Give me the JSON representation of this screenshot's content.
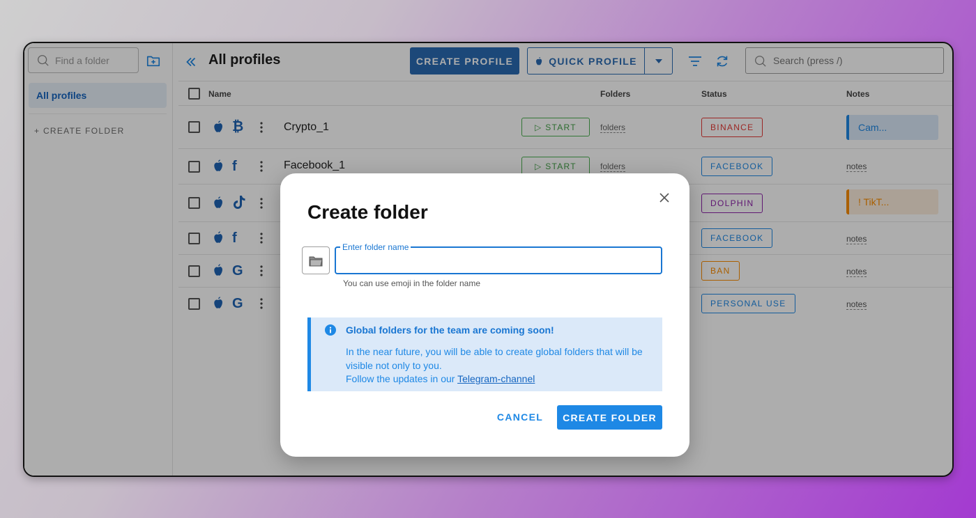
{
  "sidebar": {
    "find_placeholder": "Find a folder",
    "all_profiles": "All profiles",
    "create_folder": "+ CREATE FOLDER"
  },
  "header": {
    "title": "All profiles",
    "create_profile": "CREATE PROFILE",
    "quick_profile": "QUICK PROFILE",
    "search_placeholder": "Search (press /)"
  },
  "table": {
    "columns": {
      "name": "Name",
      "folders": "Folders",
      "status": "Status",
      "notes": "Notes"
    },
    "rows": [
      {
        "name": "Crypto_1",
        "service": "₿",
        "start": "▷ START",
        "folders": "folders",
        "status": "BINANCE",
        "status_color": "#e53935",
        "note": "Cam...",
        "note_type": "chip-blue"
      },
      {
        "name": "Facebook_1",
        "service": "f",
        "start": "▷ START",
        "folders": "folders",
        "status": "FACEBOOK",
        "status_color": "#1e88e5",
        "note": "notes",
        "note_type": "link"
      },
      {
        "name": "",
        "service": "tiktok",
        "start": "",
        "folders": "",
        "status": "DOLPHIN",
        "status_color": "#8e24aa",
        "note": "!   TikT...",
        "note_type": "chip-orange"
      },
      {
        "name": "",
        "service": "f",
        "start": "",
        "folders": "",
        "status": "FACEBOOK",
        "status_color": "#1e88e5",
        "note": "notes",
        "note_type": "link"
      },
      {
        "name": "",
        "service": "G",
        "start": "",
        "folders": "",
        "status": "BAN",
        "status_color": "#fb8c00",
        "note": "notes",
        "note_type": "link"
      },
      {
        "name": "",
        "service": "G",
        "start": "",
        "folders": "",
        "status": "PERSONAL USE",
        "status_color": "#1e88e5",
        "note": "notes",
        "note_type": "link"
      }
    ]
  },
  "dialog": {
    "title": "Create folder",
    "field_label": "Enter folder name",
    "field_value": "",
    "helper": "You can use emoji in the folder name",
    "info_title": "Global folders for the team are coming soon!",
    "info_text": "In the near future, you will be able to create global folders that will be visible not only to you.",
    "info_follow": "Follow the updates in our ",
    "info_link": "Telegram-channel",
    "cancel": "CANCEL",
    "create": "CREATE FOLDER"
  },
  "colors": {
    "accent": "#1e88e5",
    "brand_dark": "#2a6bb3"
  }
}
